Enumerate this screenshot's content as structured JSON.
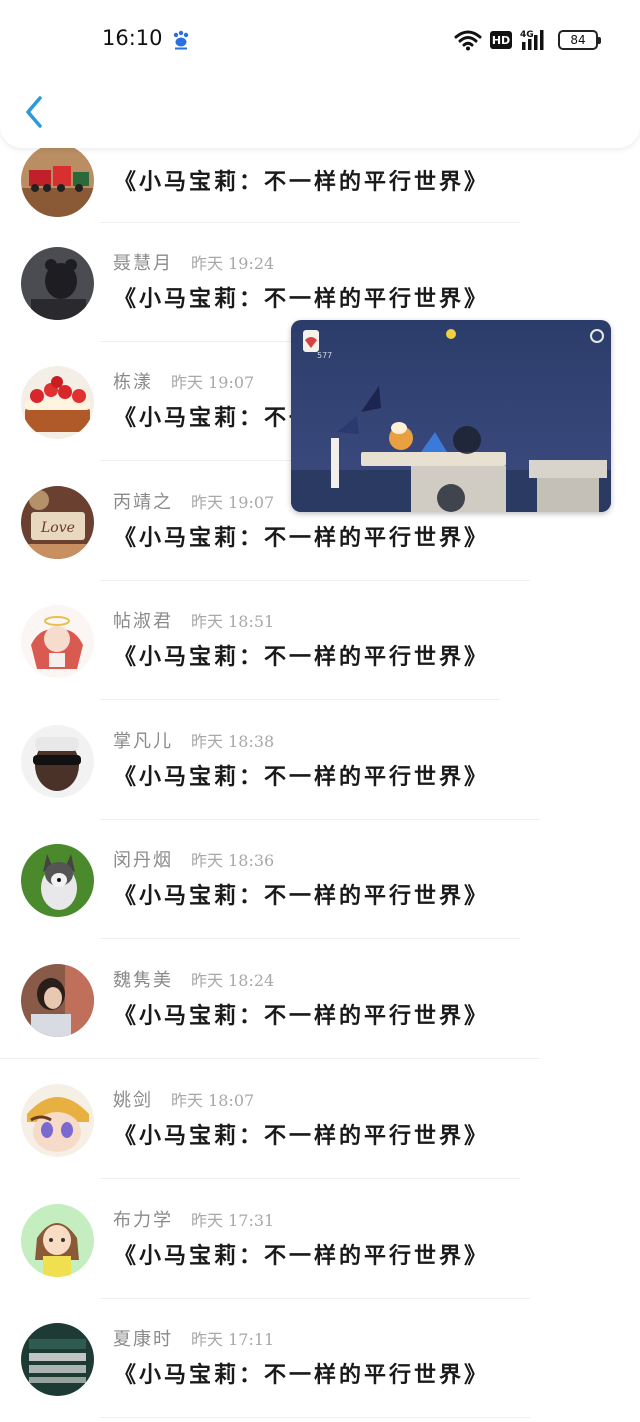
{
  "status_bar": {
    "time": "16:10",
    "network": "4G",
    "hd_label": "HD",
    "battery": "84"
  },
  "list": {
    "items": [
      {
        "name": "",
        "time": "",
        "title": "《小马宝莉：不一样的平行世界》",
        "avatar_color": "#c8a070"
      },
      {
        "name": "聂慧月",
        "time": "昨天 19:24",
        "title": "《小马宝莉：不一样的平行世界》",
        "avatar_color": "#3a3a40"
      },
      {
        "name": "栋漾",
        "time": "昨天 19:07",
        "title": "《小马宝莉：不一样的平行世界》",
        "avatar_color": "#d94b3a"
      },
      {
        "name": "丙靖之",
        "time": "昨天 19:07",
        "title": "《小马宝莉：不一样的平行世界》",
        "avatar_color": "#7a4a34"
      },
      {
        "name": "帖淑君",
        "time": "昨天 18:51",
        "title": "《小马宝莉：不一样的平行世界》",
        "avatar_color": "#e8c4c0"
      },
      {
        "name": "掌凡儿",
        "time": "昨天 18:38",
        "title": "《小马宝莉：不一样的平行世界》",
        "avatar_color": "#4a3a30"
      },
      {
        "name": "闵丹烟",
        "time": "昨天 18:36",
        "title": "《小马宝莉：不一样的平行世界》",
        "avatar_color": "#3f7a2a"
      },
      {
        "name": "魏隽美",
        "time": "昨天 18:24",
        "title": "《小马宝莉：不一样的平行世界》",
        "avatar_color": "#6b4a3c"
      },
      {
        "name": "姚剑",
        "time": "昨天 18:07",
        "title": "《小马宝莉：不一样的平行世界》",
        "avatar_color": "#e8b860"
      },
      {
        "name": "布力学",
        "time": "昨天 17:31",
        "title": "《小马宝莉：不一样的平行世界》",
        "avatar_color": "#bfe8b8"
      },
      {
        "name": "夏康时",
        "time": "昨天 17:11",
        "title": "《小马宝莉：不一样的平行世界》",
        "avatar_color": "#203a34"
      }
    ]
  },
  "pip": {
    "counter": "577"
  },
  "colors": {
    "accent": "#2a9bd8",
    "name_text": "#8a8a8a",
    "title_text": "#1a1a1a"
  }
}
